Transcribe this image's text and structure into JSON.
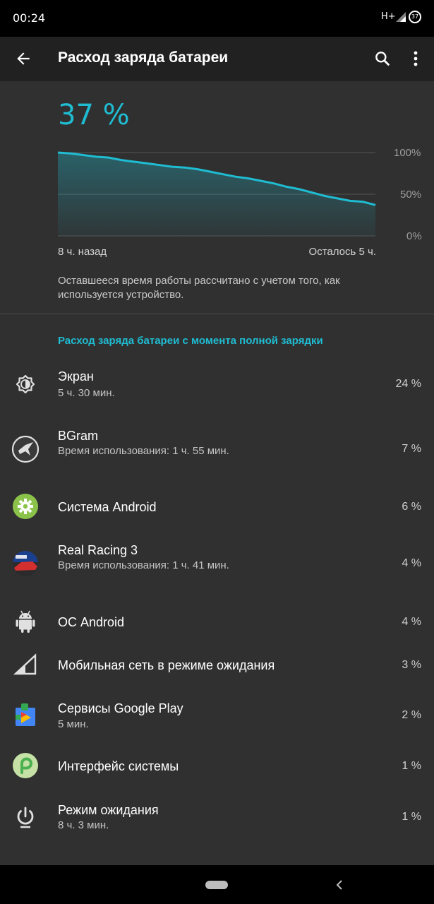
{
  "status": {
    "time": "00:24",
    "network": "H+",
    "battery": "37"
  },
  "header": {
    "title": "Расход заряда батареи"
  },
  "battery": {
    "level": "37 %",
    "level_value": 37,
    "graph": {
      "y_labels": [
        "100%",
        "50%",
        "0%"
      ],
      "x_left": "8 ч. назад",
      "x_right": "Осталось 5 ч.",
      "series": [
        100,
        99,
        97,
        95,
        94,
        91,
        89,
        87,
        85,
        83,
        82,
        80,
        77,
        74,
        71,
        69,
        66,
        63,
        59,
        56,
        52,
        48,
        45,
        42,
        41,
        37
      ]
    },
    "estimate_note": "Оставшееся время работы рассчитано с учетом того, как используется устройство."
  },
  "usage": {
    "section_title": "Расход заряда батареи с момента полной зарядки",
    "items": [
      {
        "name": "Экран",
        "sub": "5 ч. 30 мин.",
        "percent": "24 %",
        "icon": "brightness-icon"
      },
      {
        "name": "BGram",
        "sub": "Время использования: 1 ч. 55 мин.",
        "percent": "7 %",
        "icon": "bgram-app-icon"
      },
      {
        "name": "Система Android",
        "sub": "",
        "percent": "6 %",
        "icon": "android-system-gear-icon"
      },
      {
        "name": "Real Racing 3",
        "sub": "Время использования: 1 ч. 41 мин.",
        "percent": "4 %",
        "icon": "real-racing-app-icon"
      },
      {
        "name": "ОС Android",
        "sub": "",
        "percent": "4 %",
        "icon": "android-robot-icon"
      },
      {
        "name": "Мобильная сеть в режиме ожидания",
        "sub": "",
        "percent": "3 %",
        "icon": "cell-signal-icon"
      },
      {
        "name": "Сервисы Google Play",
        "sub": "5 мин.",
        "percent": "2 %",
        "icon": "google-play-services-icon"
      },
      {
        "name": "Интерфейс системы",
        "sub": "",
        "percent": "1 %",
        "icon": "android-pie-icon"
      },
      {
        "name": "Режим ожидания",
        "sub": "8 ч. 3 мин.",
        "percent": "1 %",
        "icon": "power-icon"
      }
    ]
  },
  "colors": {
    "accent": "#1fbcd2",
    "background": "#303030",
    "appbar": "#212121"
  }
}
